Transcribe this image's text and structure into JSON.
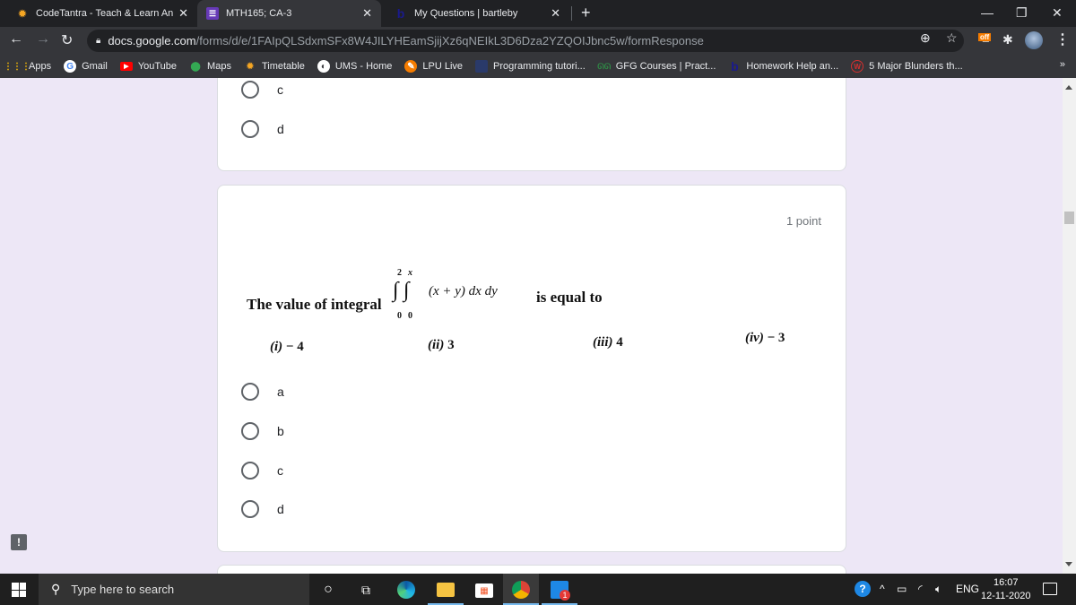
{
  "browser": {
    "tabs": [
      {
        "title": "CodeTantra - Teach & Learn Anyw",
        "icon": "codetantra-icon",
        "active": false
      },
      {
        "title": "MTH165; CA-3",
        "icon": "google-forms-icon",
        "active": true
      },
      {
        "title": "My Questions | bartleby",
        "icon": "bartleby-icon",
        "active": false
      }
    ],
    "url_host": "docs.google.com",
    "url_path": "/forms/d/e/1FAIpQLSdxmSFx8W4JILYHEamSjijXz6qNEIkL3D6Dza2YZQOIJbnc5w/formResponse",
    "extension_badge": "off",
    "bookmarks": [
      {
        "label": "Apps",
        "icon": "apps-grid-icon"
      },
      {
        "label": "Gmail",
        "icon": "google-icon"
      },
      {
        "label": "YouTube",
        "icon": "youtube-icon"
      },
      {
        "label": "Maps",
        "icon": "maps-pin-icon"
      },
      {
        "label": "Timetable",
        "icon": "codetantra-icon"
      },
      {
        "label": "UMS - Home",
        "icon": "globe-icon"
      },
      {
        "label": "LPU Live",
        "icon": "lpu-live-icon"
      },
      {
        "label": "Programming tutori...",
        "icon": "programming-icon"
      },
      {
        "label": "GFG Courses | Pract...",
        "icon": "gfg-icon"
      },
      {
        "label": "Homework Help an...",
        "icon": "bartleby-icon"
      },
      {
        "label": "5 Major Blunders th...",
        "icon": "w-icon"
      }
    ],
    "bookmarks_more": "»"
  },
  "form": {
    "prev_question": {
      "options": [
        "c",
        "d"
      ]
    },
    "question": {
      "points": "1 point",
      "prompt_prefix": "The value of integral",
      "integral_outer_upper": "2",
      "integral_outer_lower": "0",
      "integral_inner_upper": "x",
      "integral_inner_lower": "0",
      "integrand": "(x + y) dx dy",
      "prompt_suffix": "is equal to",
      "image_options": [
        {
          "num": "(i)",
          "value": "− 4"
        },
        {
          "num": "(ii)",
          "value": "3"
        },
        {
          "num": "(iii)",
          "value": "4"
        },
        {
          "num": "(iv)",
          "value": "− 3"
        }
      ],
      "options": [
        "a",
        "b",
        "c",
        "d"
      ]
    }
  },
  "taskbar": {
    "search_placeholder": "Type here to search",
    "language": "ENG",
    "time": "16:07",
    "date": "12-11-2020",
    "whatsapp_badge": "1"
  }
}
